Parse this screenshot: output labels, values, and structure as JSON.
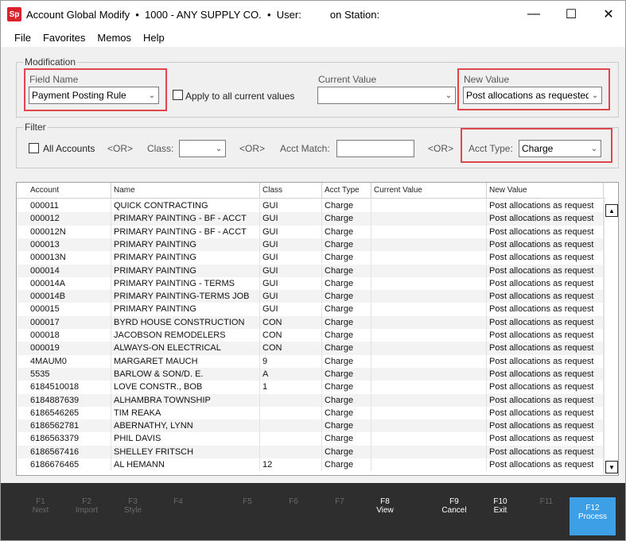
{
  "title_bar": {
    "icon_text": "Sp",
    "title": "Account Global Modify  •  1000 - ANY SUPPLY CO.  •  User:          on Station:",
    "minimize": "—",
    "maximize": "☐",
    "close": "✕"
  },
  "menu": [
    "File",
    "Favorites",
    "Memos",
    "Help"
  ],
  "modification": {
    "legend": "Modification",
    "field_name_label": "Field Name",
    "field_name_value": "Payment Posting Rule",
    "apply_all_label": "Apply to all current values",
    "current_value_label": "Current Value",
    "current_value_value": "",
    "new_value_label": "New Value",
    "new_value_value": "Post allocations as requested"
  },
  "filter": {
    "legend": "Filter",
    "all_accounts_label": "All Accounts",
    "or1": "<OR>",
    "class_label": "Class:",
    "class_value": "",
    "or2": "<OR>",
    "acct_match_label": "Acct Match:",
    "acct_match_value": "",
    "or3": "<OR>",
    "acct_type_label": "Acct Type:",
    "acct_type_value": "Charge"
  },
  "grid": {
    "columns": [
      "Account",
      "Name",
      "Class",
      "Acct Type",
      "Current Value",
      "New Value"
    ],
    "rows": [
      [
        "000011",
        "QUICK CONTRACTING",
        "GUI",
        "Charge",
        "",
        "Post allocations as request"
      ],
      [
        "000012",
        "PRIMARY PAINTING - BF - ACCT",
        "GUI",
        "Charge",
        "",
        "Post allocations as request"
      ],
      [
        "000012N",
        "PRIMARY PAINTING - BF - ACCT",
        "GUI",
        "Charge",
        "",
        "Post allocations as request"
      ],
      [
        "000013",
        "PRIMARY PAINTING",
        "GUI",
        "Charge",
        "",
        "Post allocations as request"
      ],
      [
        "000013N",
        "PRIMARY PAINTING",
        "GUI",
        "Charge",
        "",
        "Post allocations as request"
      ],
      [
        "000014",
        "PRIMARY PAINTING",
        "GUI",
        "Charge",
        "",
        "Post allocations as request"
      ],
      [
        "000014A",
        "PRIMARY PAINTING - TERMS",
        "GUI",
        "Charge",
        "",
        "Post allocations as request"
      ],
      [
        "000014B",
        "PRIMARY PAINTING-TERMS JOB",
        "GUI",
        "Charge",
        "",
        "Post allocations as request"
      ],
      [
        "000015",
        "PRIMARY PAINTING",
        "GUI",
        "Charge",
        "",
        "Post allocations as request"
      ],
      [
        "000017",
        "BYRD HOUSE CONSTRUCTION",
        "CON",
        "Charge",
        "",
        "Post allocations as request"
      ],
      [
        "000018",
        "JACOBSON REMODELERS",
        "CON",
        "Charge",
        "",
        "Post allocations as request"
      ],
      [
        "000019",
        "ALWAYS-ON ELECTRICAL",
        "CON",
        "Charge",
        "",
        "Post allocations as request"
      ],
      [
        "4MAUM0",
        "MARGARET MAUCH",
        "9",
        "Charge",
        "",
        "Post allocations as request"
      ],
      [
        "5535",
        "BARLOW & SON/D. E.",
        "A",
        "Charge",
        "",
        "Post allocations as request"
      ],
      [
        "6184510018",
        "LOVE CONSTR., BOB",
        "1",
        "Charge",
        "",
        "Post allocations as request"
      ],
      [
        "6184887639",
        "ALHAMBRA TOWNSHIP",
        "",
        "Charge",
        "",
        "Post allocations as request"
      ],
      [
        "6186546265",
        "TIM REAKA",
        "",
        "Charge",
        "",
        "Post allocations as request"
      ],
      [
        "6186562781",
        "ABERNATHY, LYNN",
        "",
        "Charge",
        "",
        "Post allocations as request"
      ],
      [
        "6186563379",
        "PHIL DAVIS",
        "",
        "Charge",
        "",
        "Post allocations as request"
      ],
      [
        "6186567416",
        "SHELLEY FRITSCH",
        "",
        "Charge",
        "",
        "Post allocations as request"
      ],
      [
        "6186676465",
        "AL HEMANN",
        "12",
        "Charge",
        "",
        "Post allocations as request"
      ]
    ]
  },
  "fkeys": [
    {
      "key": "F1",
      "action": "Next",
      "state": "disabled"
    },
    {
      "key": "F2",
      "action": "Import",
      "state": "disabled"
    },
    {
      "key": "F3",
      "action": "Style",
      "state": "disabled"
    },
    {
      "key": "F4",
      "action": "",
      "state": "disabled"
    },
    {
      "key": "F5",
      "action": "",
      "state": "disabled"
    },
    {
      "key": "F6",
      "action": "",
      "state": "disabled"
    },
    {
      "key": "F7",
      "action": "",
      "state": "disabled"
    },
    {
      "key": "F8",
      "action": "View",
      "state": "enabled"
    },
    {
      "key": "F9",
      "action": "Cancel",
      "state": "enabled"
    },
    {
      "key": "F10",
      "action": "Exit",
      "state": "enabled"
    },
    {
      "key": "F11",
      "action": "",
      "state": "disabled"
    },
    {
      "key": "F12",
      "action": "Process",
      "state": "primary"
    }
  ],
  "colors": {
    "highlight_border": "#e0474c",
    "fkey_primary": "#3d9fe6",
    "fkey_bar": "#2e2e2e",
    "app_icon": "#d9232e"
  }
}
